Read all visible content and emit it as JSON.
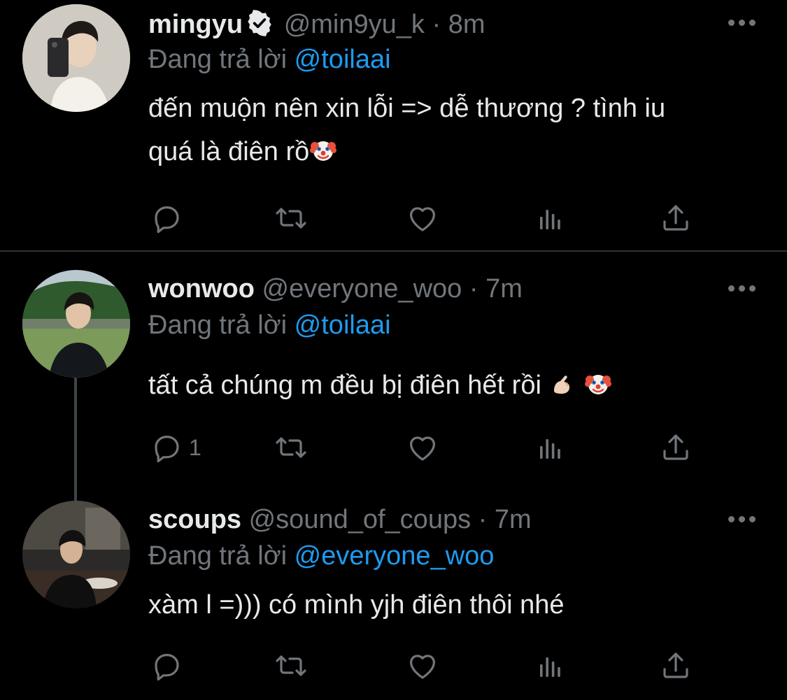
{
  "tweets": [
    {
      "name": "mingyu",
      "handle": "@min9yu_k",
      "time": "8m",
      "reply_prefix": "Đang trả lời",
      "reply_to": "@toilaai",
      "text_line1": "đến muộn nên xin lỗi => dễ thương ? tình iu",
      "text_line2": "quá là điên rồ",
      "reply_count": ""
    },
    {
      "name": "wonwoo",
      "handle": "@everyone_woo",
      "time": "7m",
      "reply_prefix": "Đang trả lời",
      "reply_to": "@toilaai",
      "text": "tất cả chúng m đều bị điên hết rồi",
      "reply_count": "1"
    },
    {
      "name": "scoups",
      "handle": "@sound_of_coups",
      "time": "7m",
      "reply_prefix": "Đang trả lời",
      "reply_to": "@everyone_woo",
      "text": "xàm l =))) có mình yjh điên thôi nhé",
      "reply_count": ""
    }
  ],
  "separator": "·",
  "icons": [
    "reply-icon",
    "retweet-icon",
    "like-icon",
    "views-icon",
    "share-icon",
    "more-icon",
    "verified-icon",
    "clown-emoji",
    "pinch-emoji"
  ],
  "colors": {
    "accent": "#1d9bf0",
    "muted": "#71767b",
    "text": "#e7e9ea",
    "background": "#000000"
  }
}
